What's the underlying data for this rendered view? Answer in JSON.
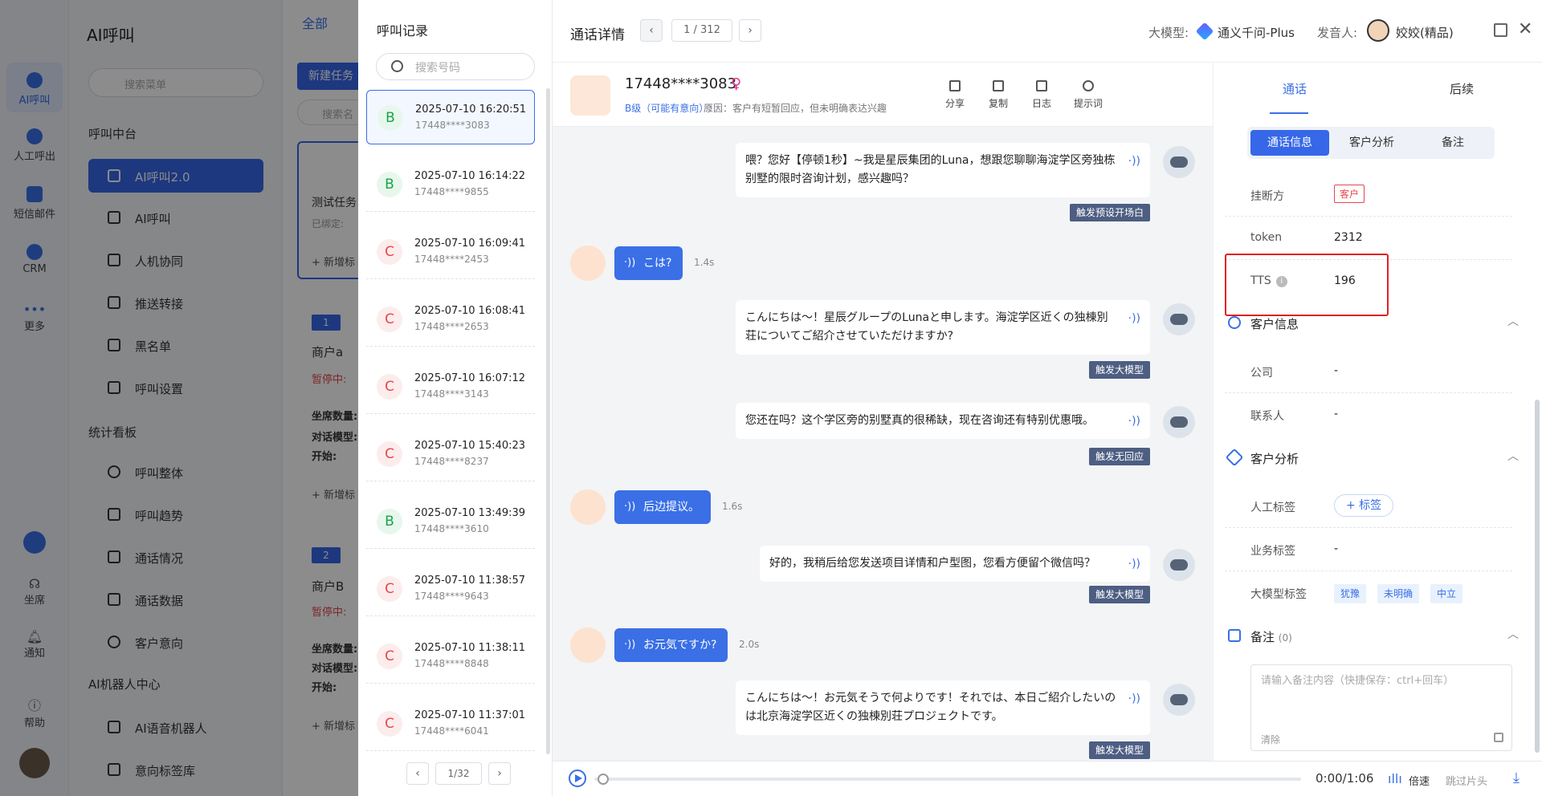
{
  "rail": {
    "items": [
      {
        "label": "AI呼叫"
      },
      {
        "label": "人工呼出"
      },
      {
        "label": "短信邮件"
      },
      {
        "label": "CRM"
      },
      {
        "label": "更多"
      },
      {
        "label": "坐席"
      },
      {
        "label": "通知"
      },
      {
        "label": "帮助"
      }
    ]
  },
  "menu": {
    "title": "AI呼叫",
    "search_placeholder": "搜索菜单",
    "sections": [
      "呼叫中台",
      "统计看板",
      "AI机器人中心"
    ],
    "items": [
      {
        "label": "AI呼叫2.0"
      },
      {
        "label": "AI呼叫"
      },
      {
        "label": "人机协同"
      },
      {
        "label": "推送转接"
      },
      {
        "label": "黑名单"
      },
      {
        "label": "呼叫设置"
      },
      {
        "label": "呼叫整体"
      },
      {
        "label": "呼叫趋势"
      },
      {
        "label": "通话情况"
      },
      {
        "label": "通话数据"
      },
      {
        "label": "客户意向"
      },
      {
        "label": "AI语音机器人"
      },
      {
        "label": "意向标签库"
      }
    ]
  },
  "background": {
    "tab_all": "全部",
    "new_task": "新建任务",
    "search": "搜索名",
    "task1": "测试任务",
    "bound": "已绑定:",
    "add_tag": "+ 新增标",
    "merchant_a": "商户a",
    "merchant_b": "商户B",
    "paused": "暂停中:",
    "seats": "坐席数量:",
    "model": "对话模型:",
    "start": "开始:",
    "badge1": "1",
    "badge2": "2"
  },
  "records": {
    "title": "呼叫记录",
    "search_placeholder": "搜索号码",
    "items": [
      {
        "grade": "B",
        "time": "2025-07-10 16:20:51",
        "number": "17448****3083"
      },
      {
        "grade": "B",
        "time": "2025-07-10 16:14:22",
        "number": "17448****9855"
      },
      {
        "grade": "C",
        "time": "2025-07-10 16:09:41",
        "number": "17448****2453"
      },
      {
        "grade": "C",
        "time": "2025-07-10 16:08:41",
        "number": "17448****2653"
      },
      {
        "grade": "C",
        "time": "2025-07-10 16:07:12",
        "number": "17448****3143"
      },
      {
        "grade": "C",
        "time": "2025-07-10 15:40:23",
        "number": "17448****8237"
      },
      {
        "grade": "B",
        "time": "2025-07-10 13:49:39",
        "number": "17448****3610"
      },
      {
        "grade": "C",
        "time": "2025-07-10 11:38:57",
        "number": "17448****9643"
      },
      {
        "grade": "C",
        "time": "2025-07-10 11:38:11",
        "number": "17448****8848"
      },
      {
        "grade": "C",
        "time": "2025-07-10 11:37:01",
        "number": "17448****6041"
      }
    ],
    "pager": "1/32"
  },
  "detail": {
    "title": "通话详情",
    "page_info": "1 / 312",
    "model_label": "大模型:",
    "model_value": "通义千问-Plus",
    "voice_label": "发音人:",
    "voice_value": "姣姣(精品)",
    "customer": {
      "phone": "17448****3083",
      "gender": "♀",
      "grade": "B级（可能有意向）:",
      "reason": "原因：客户有短暂回应，但未明确表达兴趣"
    },
    "actions": [
      {
        "label": "分享"
      },
      {
        "label": "复制"
      },
      {
        "label": "日志"
      },
      {
        "label": "提示词"
      }
    ],
    "messages": [
      {
        "role": "bot",
        "text": "喂？您好【停顿1秒】~我是星辰集团的Luna，想跟您聊聊海淀学区旁独栋别墅的限时咨询计划，感兴趣吗？",
        "tag": "触发预设开场白"
      },
      {
        "role": "user",
        "text": "こは?",
        "duration": "1.4s"
      },
      {
        "role": "bot",
        "text": "こんにちは～！星辰グループのLunaと申します。海淀学区近くの独棟別荘についてご紹介させていただけますか?",
        "tag": "触发大模型"
      },
      {
        "role": "bot",
        "text": "您还在吗？这个学区旁的别墅真的很稀缺，现在咨询还有特别优惠哦。",
        "tag": "触发无回应"
      },
      {
        "role": "user",
        "text": "后边提议。",
        "duration": "1.6s"
      },
      {
        "role": "bot",
        "text": "好的，我稍后给您发送项目详情和户型图，您看方便留个微信吗？",
        "tag": "触发大模型"
      },
      {
        "role": "user",
        "text": "お元気ですか?",
        "duration": "2.0s"
      },
      {
        "role": "bot",
        "text": "こんにちは～！お元気そうで何よりです！それでは、本日ご紹介したいのは北京海淀学区近くの独棟別荘プロジェクトです。",
        "tag": "触发大模型"
      }
    ],
    "player": {
      "time": "0:00/1:06",
      "speed": "倍速",
      "skip": "跳过片头",
      "progress": 0
    }
  },
  "right": {
    "tabs": [
      "通话",
      "后续"
    ],
    "segments": [
      "通话信息",
      "客户分析",
      "备注"
    ],
    "call_info": [
      {
        "label": "挂断方",
        "value": "客户"
      },
      {
        "label": "token",
        "value": "2312"
      },
      {
        "label": "TTS",
        "value": "196"
      }
    ],
    "customer_info_title": "客户信息",
    "customer_info": [
      {
        "label": "公司",
        "value": "-"
      },
      {
        "label": "联系人",
        "value": "-"
      }
    ],
    "analysis_title": "客户分析",
    "analysis": {
      "manual_label": "人工标签",
      "add_tag": "+ 标签",
      "business_label": "业务标签",
      "business_value": "-",
      "llm_label": "大模型标签",
      "llm_tags": [
        "犹豫",
        "未明确",
        "中立"
      ]
    },
    "notes_title": "备注",
    "notes_count": "(0)",
    "notes_placeholder": "请输入备注内容（快捷保存：ctrl+回车）",
    "notes_clear": "清除"
  }
}
